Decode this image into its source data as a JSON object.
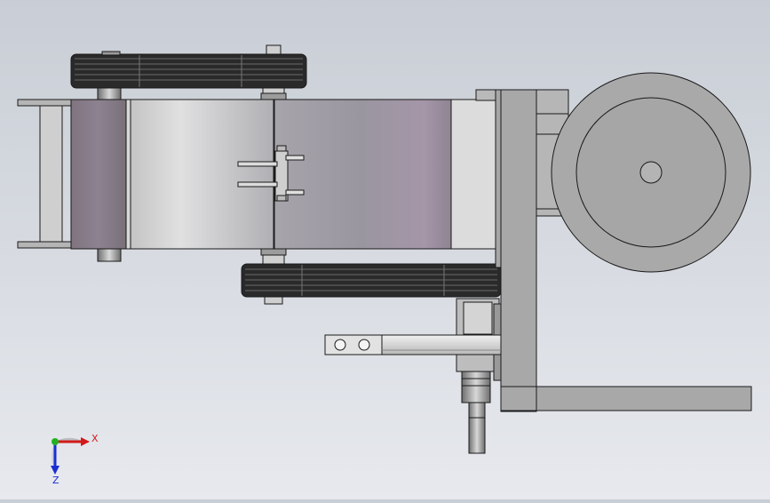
{
  "view": {
    "background_top": "#c9ced6",
    "background_bottom": "#e7e9ee",
    "edge_color": "#1a1a1a"
  },
  "triad": {
    "x_label": "X",
    "z_label": "Z",
    "x_color": "#d21a1a",
    "y_color": "#22b222",
    "z_color": "#1a2fd2"
  },
  "parts": {
    "belt_color": "#2a2a2a",
    "drum_color": "#8a7c88",
    "frame_color": "#a8a8a8",
    "wheel_color": "#a9a9a9"
  }
}
